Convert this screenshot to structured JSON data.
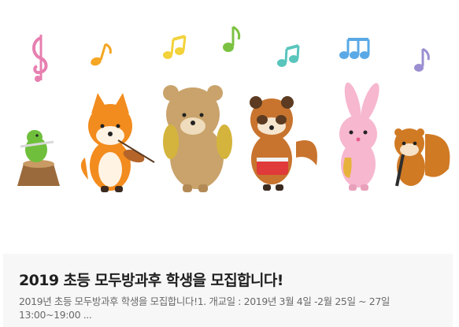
{
  "post": {
    "title": "2019 초등 모두방과후 학생을 모집합니다!",
    "summary": "2019년 초등 모두방과후 학생을 모집합니다!1. 개교일 : 2019년 3월 4일 -2월 25일 ~ 27일 13:00~19:00 ..."
  },
  "banner": {
    "illustration": "animal-band-music-notes",
    "colors": {
      "background": "#ffffff",
      "fox": "#f28c1e",
      "bear": "#c9a36b",
      "raccoon": "#c8742e",
      "rabbit": "#f6b7cf",
      "squirrel": "#d07a24",
      "bird": "#6fbf3c",
      "note_pink": "#e77fb0",
      "note_orange": "#f5a623",
      "note_yellow": "#f3d23a",
      "note_green": "#7cc242",
      "note_teal": "#59c5bd",
      "note_blue": "#5aa9e6",
      "note_purple": "#9b8fd1"
    }
  }
}
